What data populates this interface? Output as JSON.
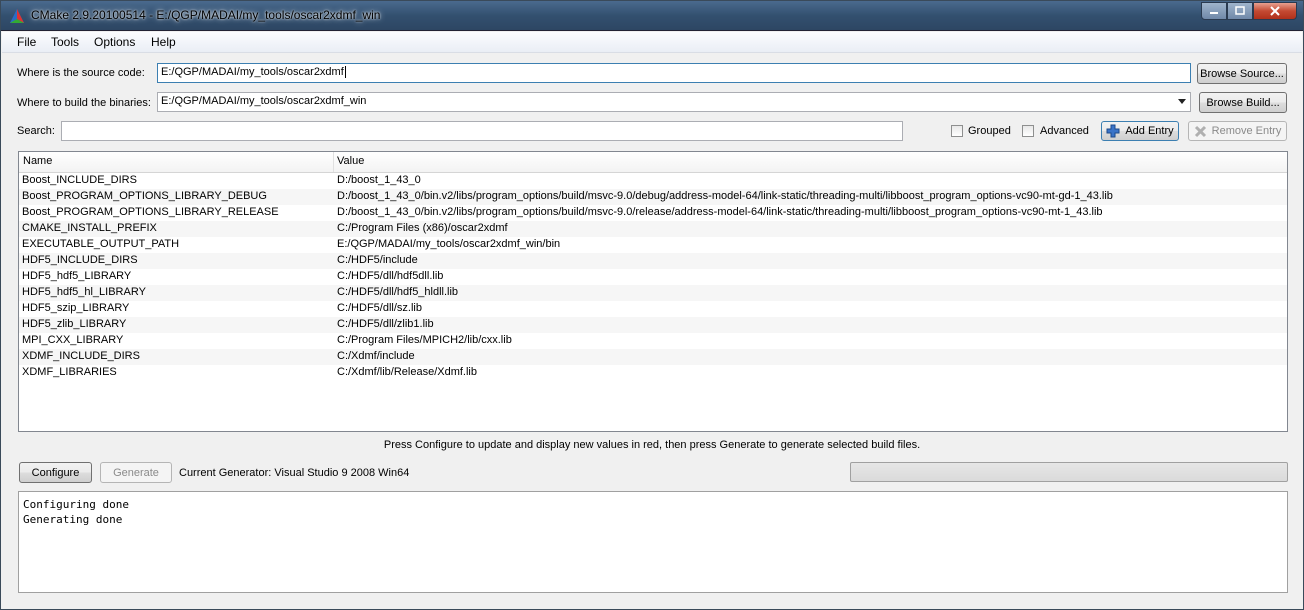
{
  "window": {
    "title": "CMake 2.9.20100514 - E:/QGP/MADAI/my_tools/oscar2xdmf_win",
    "app_icon": "cmake-triangle-icon"
  },
  "menu": [
    "File",
    "Tools",
    "Options",
    "Help"
  ],
  "source": {
    "label": "Where is the source code:",
    "value": "E:/QGP/MADAI/my_tools/oscar2xdmf",
    "button": "Browse Source..."
  },
  "build": {
    "label": "Where to build the binaries:",
    "value": "E:/QGP/MADAI/my_tools/oscar2xdmf_win",
    "button": "Browse Build..."
  },
  "search": {
    "label": "Search:",
    "value": "",
    "grouped": "Grouped",
    "advanced": "Advanced",
    "add_entry": "Add Entry",
    "remove_entry": "Remove Entry"
  },
  "table": {
    "headers": [
      "Name",
      "Value"
    ],
    "rows": [
      [
        "Boost_INCLUDE_DIRS",
        "D:/boost_1_43_0"
      ],
      [
        "Boost_PROGRAM_OPTIONS_LIBRARY_DEBUG",
        "D:/boost_1_43_0/bin.v2/libs/program_options/build/msvc-9.0/debug/address-model-64/link-static/threading-multi/libboost_program_options-vc90-mt-gd-1_43.lib"
      ],
      [
        "Boost_PROGRAM_OPTIONS_LIBRARY_RELEASE",
        "D:/boost_1_43_0/bin.v2/libs/program_options/build/msvc-9.0/release/address-model-64/link-static/threading-multi/libboost_program_options-vc90-mt-1_43.lib"
      ],
      [
        "CMAKE_INSTALL_PREFIX",
        "C:/Program Files (x86)/oscar2xdmf"
      ],
      [
        "EXECUTABLE_OUTPUT_PATH",
        "E:/QGP/MADAI/my_tools/oscar2xdmf_win/bin"
      ],
      [
        "HDF5_INCLUDE_DIRS",
        "C:/HDF5/include"
      ],
      [
        "HDF5_hdf5_LIBRARY",
        "C:/HDF5/dll/hdf5dll.lib"
      ],
      [
        "HDF5_hdf5_hl_LIBRARY",
        "C:/HDF5/dll/hdf5_hldll.lib"
      ],
      [
        "HDF5_szip_LIBRARY",
        "C:/HDF5/dll/sz.lib"
      ],
      [
        "HDF5_zlib_LIBRARY",
        "C:/HDF5/dll/zlib1.lib"
      ],
      [
        "MPI_CXX_LIBRARY",
        "C:/Program Files/MPICH2/lib/cxx.lib"
      ],
      [
        "XDMF_INCLUDE_DIRS",
        "C:/Xdmf/include"
      ],
      [
        "XDMF_LIBRARIES",
        "C:/Xdmf/lib/Release/Xdmf.lib"
      ]
    ]
  },
  "hint": "Press Configure to update and display new values in red, then press Generate to generate selected build files.",
  "actions": {
    "configure": "Configure",
    "generate": "Generate",
    "generator": "Current Generator: Visual Studio 9 2008 Win64"
  },
  "progress": 0,
  "output": [
    "Configuring done",
    "Generating done"
  ]
}
